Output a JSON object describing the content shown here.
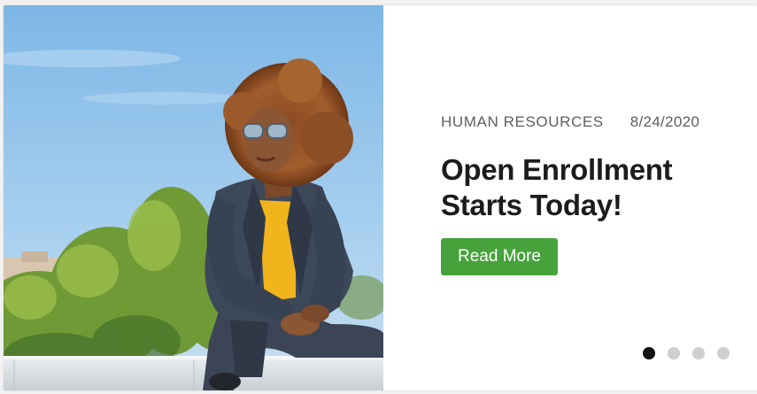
{
  "article": {
    "category": "HUMAN RESOURCES",
    "date": "8/24/2020",
    "headline_line1": "Open Enrollment",
    "headline_line2": "Starts Today!",
    "cta_label": "Read More"
  },
  "carousel": {
    "slide_count": 4,
    "active_index": 0
  },
  "colors": {
    "cta_background": "#46a23b",
    "dot_active": "#111111",
    "dot_inactive": "#cfcfcf"
  }
}
